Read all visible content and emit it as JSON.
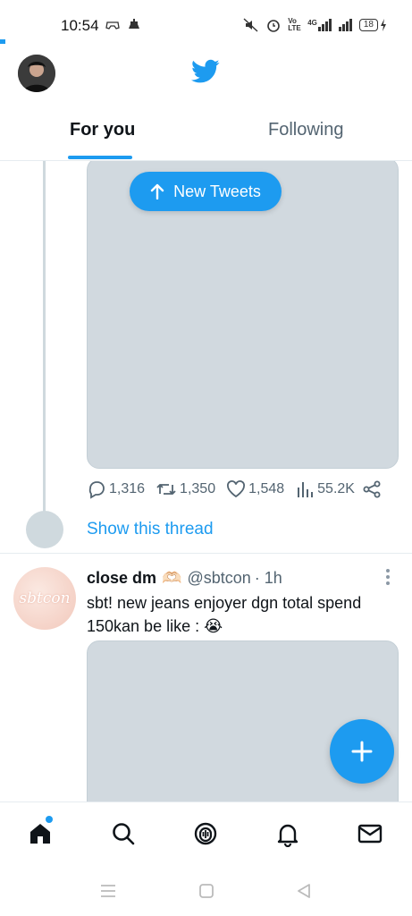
{
  "status_bar": {
    "time": "10:54",
    "left_icons": [
      "gamepad-icon",
      "notification-icon"
    ],
    "right_icons": [
      "mute-icon",
      "alarm-icon",
      "volte-icon",
      "4g-signal-icon",
      "signal-icon"
    ],
    "volte_label": "Vo LTE",
    "network_label": "4G",
    "battery_level": "18"
  },
  "header": {
    "logo": "twitter-bird-icon",
    "tabs": [
      {
        "label": "For you",
        "active": true
      },
      {
        "label": "Following",
        "active": false
      }
    ]
  },
  "new_tweets_pill": {
    "label": "New Tweets",
    "icon": "arrow-up-icon"
  },
  "tweet1": {
    "stats": {
      "replies": "1,316",
      "retweets": "1,350",
      "likes": "1,548",
      "views": "55.2K"
    },
    "show_thread": "Show this thread"
  },
  "tweet2": {
    "avatar_text": "sbtcon",
    "name": "close dm",
    "name_emoji": "🫶🏻",
    "handle": "@sbtcon",
    "time": "· 1h",
    "text": "sbt! new jeans enjoyer dgn total spend 150kan be like : 😭"
  },
  "bottom_nav": {
    "items": [
      "home-icon",
      "search-icon",
      "spaces-icon",
      "notifications-icon",
      "messages-icon"
    ]
  },
  "colors": {
    "accent": "#1d9bf0",
    "text": "#0f1419",
    "muted": "#536471",
    "placeholder": "#d1d9df"
  }
}
